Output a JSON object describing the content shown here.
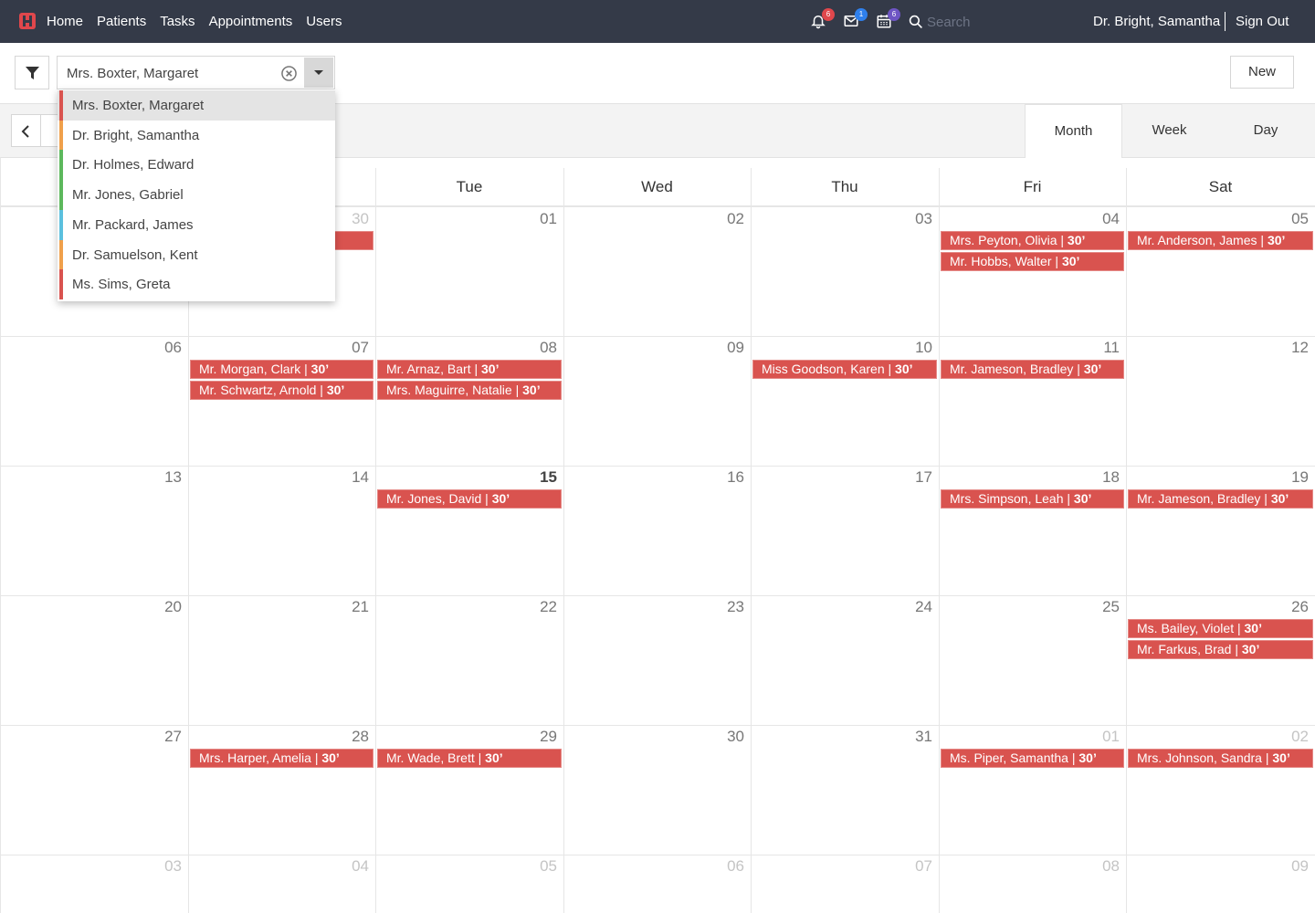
{
  "nav": {
    "items": [
      "Home",
      "Patients",
      "Tasks",
      "Appointments",
      "Users"
    ],
    "notifications": {
      "count": "6",
      "color": "#e0474c"
    },
    "messages": {
      "count": "1",
      "color": "#2f80ed"
    },
    "calendar": {
      "count": "6",
      "color": "#6e55c4"
    },
    "search_placeholder": "Search",
    "user": "Dr. Bright, Samantha",
    "sign_out": "Sign Out"
  },
  "toolbar": {
    "filter_value": "Mrs. Boxter, Margaret",
    "new_label": "New"
  },
  "views": [
    "Month",
    "Week",
    "Day"
  ],
  "active_view": "Month",
  "dropdown": [
    {
      "label": "Mrs. Boxter, Margaret",
      "color": "#d9534f",
      "selected": true
    },
    {
      "label": "Dr. Bright, Samantha",
      "color": "#f0a04b"
    },
    {
      "label": "Dr. Holmes, Edward",
      "color": "#5cb85c"
    },
    {
      "label": "Mr. Jones, Gabriel",
      "color": "#5cb85c"
    },
    {
      "label": "Mr. Packard, James",
      "color": "#5bc0de"
    },
    {
      "label": "Dr. Samuelson, Kent",
      "color": "#f0a04b"
    },
    {
      "label": "Ms. Sims, Greta",
      "color": "#d9534f"
    }
  ],
  "day_headers": [
    "",
    "",
    "Tue",
    "Wed",
    "Thu",
    "Fri",
    "Sat"
  ],
  "weeks": [
    {
      "days": [
        {
          "n": "",
          "o": true
        },
        {
          "n": "30",
          "o": true
        },
        {
          "n": "01"
        },
        {
          "n": "02"
        },
        {
          "n": "03"
        },
        {
          "n": "04",
          "events": [
            [
              "Mrs. Peyton, Olivia",
              "30’"
            ],
            [
              "Mr. Hobbs, Walter",
              "30’"
            ]
          ]
        },
        {
          "n": "05",
          "events": [
            [
              "Mr. Anderson, James",
              "30’"
            ]
          ]
        }
      ]
    },
    {
      "days": [
        {
          "n": "06"
        },
        {
          "n": "07",
          "events": [
            [
              "Mr. Morgan, Clark",
              "30’"
            ],
            [
              "Mr. Schwartz, Arnold",
              "30’"
            ]
          ]
        },
        {
          "n": "08",
          "events": [
            [
              "Mr. Arnaz, Bart",
              "30’"
            ],
            [
              "Mrs. Maguirre, Natalie",
              "30’"
            ]
          ]
        },
        {
          "n": "09"
        },
        {
          "n": "10",
          "events": [
            [
              "Miss Goodson, Karen",
              "30’"
            ]
          ]
        },
        {
          "n": "11",
          "events": [
            [
              "Mr. Jameson, Bradley",
              "30’"
            ]
          ]
        },
        {
          "n": "12"
        }
      ]
    },
    {
      "days": [
        {
          "n": "13"
        },
        {
          "n": "14"
        },
        {
          "n": "15",
          "today": true,
          "events": [
            [
              "Mr. Jones, David",
              "30’"
            ]
          ]
        },
        {
          "n": "16"
        },
        {
          "n": "17"
        },
        {
          "n": "18",
          "events": [
            [
              "Mrs. Simpson, Leah",
              "30’"
            ]
          ]
        },
        {
          "n": "19",
          "events": [
            [
              "Mr. Jameson, Bradley",
              "30’"
            ]
          ]
        }
      ]
    },
    {
      "days": [
        {
          "n": "20"
        },
        {
          "n": "21"
        },
        {
          "n": "22"
        },
        {
          "n": "23"
        },
        {
          "n": "24"
        },
        {
          "n": "25"
        },
        {
          "n": "26",
          "events": [
            [
              "Ms. Bailey, Violet",
              "30’"
            ],
            [
              "Mr. Farkus, Brad",
              "30’"
            ]
          ]
        }
      ]
    },
    {
      "days": [
        {
          "n": "27"
        },
        {
          "n": "28",
          "events": [
            [
              "Mrs. Harper, Amelia",
              "30’"
            ]
          ]
        },
        {
          "n": "29",
          "events": [
            [
              "Mr. Wade, Brett",
              "30’"
            ]
          ]
        },
        {
          "n": "30"
        },
        {
          "n": "31"
        },
        {
          "n": "01",
          "o": true,
          "events": [
            [
              "Ms. Piper, Samantha",
              "30’"
            ]
          ]
        },
        {
          "n": "02",
          "o": true,
          "events": [
            [
              "Mrs. Johnson, Sandra",
              "30’"
            ]
          ]
        }
      ]
    },
    {
      "days": [
        {
          "n": "03",
          "o": true
        },
        {
          "n": "04",
          "o": true
        },
        {
          "n": "05",
          "o": true
        },
        {
          "n": "06",
          "o": true
        },
        {
          "n": "07",
          "o": true
        },
        {
          "n": "08",
          "o": true
        },
        {
          "n": "09",
          "o": true
        }
      ]
    }
  ],
  "hidden_event_week1_mon": true
}
